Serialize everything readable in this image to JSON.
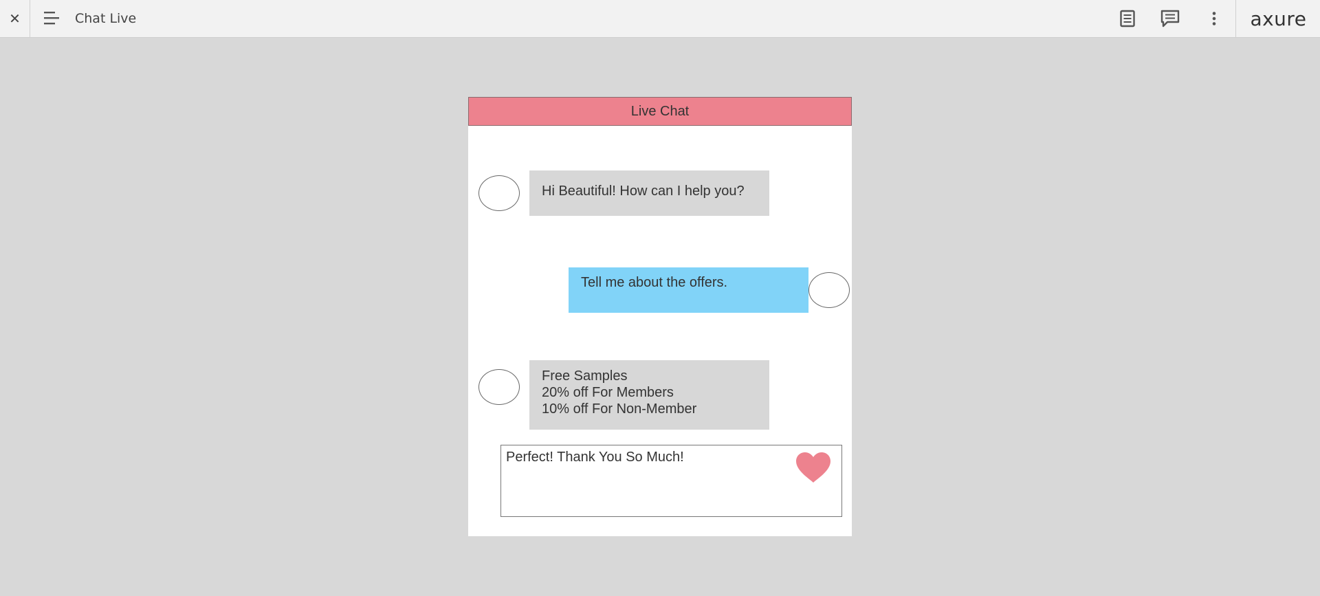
{
  "toolbar": {
    "close_glyph": "✕",
    "page_title": "Chat Live",
    "icons": [
      "close-icon",
      "menu-icon",
      "document-icon",
      "comment-icon",
      "more-vertical-icon"
    ],
    "logo": "axure"
  },
  "chat": {
    "header": "Live Chat",
    "messages": [
      {
        "sender": "agent",
        "text": "Hi Beautiful! How can I help you?"
      },
      {
        "sender": "user",
        "text": "Tell me about the offers."
      },
      {
        "sender": "agent",
        "lines": [
          "Free Samples",
          "20% off For Members",
          "10% off For Non-Member"
        ]
      }
    ],
    "reply_text": "Perfect! Thank You So Much!",
    "reply_icon": "heart-icon"
  },
  "colors": {
    "header_bg": "#ed828e",
    "agent_bubble": "#d7d7d7",
    "user_bubble": "#81d3f8",
    "heart": "#ed828e",
    "canvas_bg": "#d8d8d8"
  }
}
